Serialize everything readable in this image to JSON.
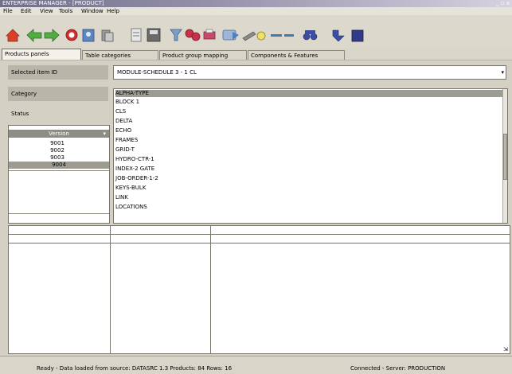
{
  "window": {
    "title": "ENTERPRISE MANAGER - [PRODUCT]",
    "controls": "_ ▫ x"
  },
  "menu": [
    "File",
    "Edit",
    "View",
    "Tools",
    "Window",
    "Help"
  ],
  "toolbar": {
    "icons": [
      "home-icon",
      "back-icon",
      "forward-icon",
      "stop-icon",
      "find-icon",
      "copy-icon",
      "paste-icon",
      "save-icon",
      "filter-icon",
      "tree-icon",
      "print-icon",
      "export-icon",
      "edit-icon",
      "delete-icon",
      "binoculars-icon",
      "refresh-icon",
      "close-icon"
    ]
  },
  "tabs": [
    "Products panels",
    "Table categories",
    "Product group mapping",
    "Components & Features"
  ],
  "form": {
    "field1_label": "Selected item ID",
    "field1_value": "MODULE-SCHEDULE 3 - 1 CL",
    "field2_label": "Category",
    "field3_label": "Status"
  },
  "left_table": {
    "header": "Version",
    "rows": [
      "9001",
      "9002",
      "9003",
      "9004"
    ]
  },
  "list": {
    "items": [
      "ALPHA-TYPE",
      "BLOCK 1",
      "CLS",
      "DELTA",
      "ECHO",
      "FRAMES",
      "GRID-T",
      "HYDRO-CTR-1",
      "INDEX-2 GATE",
      "JOB-ORDER-1-2",
      "KEYS-BULK",
      "LINK",
      "LOCATIONS"
    ]
  },
  "status": {
    "left": "Ready - Data loaded from source: DATASRC 1.3  Products: 84  Rows: 16",
    "right": "Connected - Server: PRODUCTION"
  }
}
